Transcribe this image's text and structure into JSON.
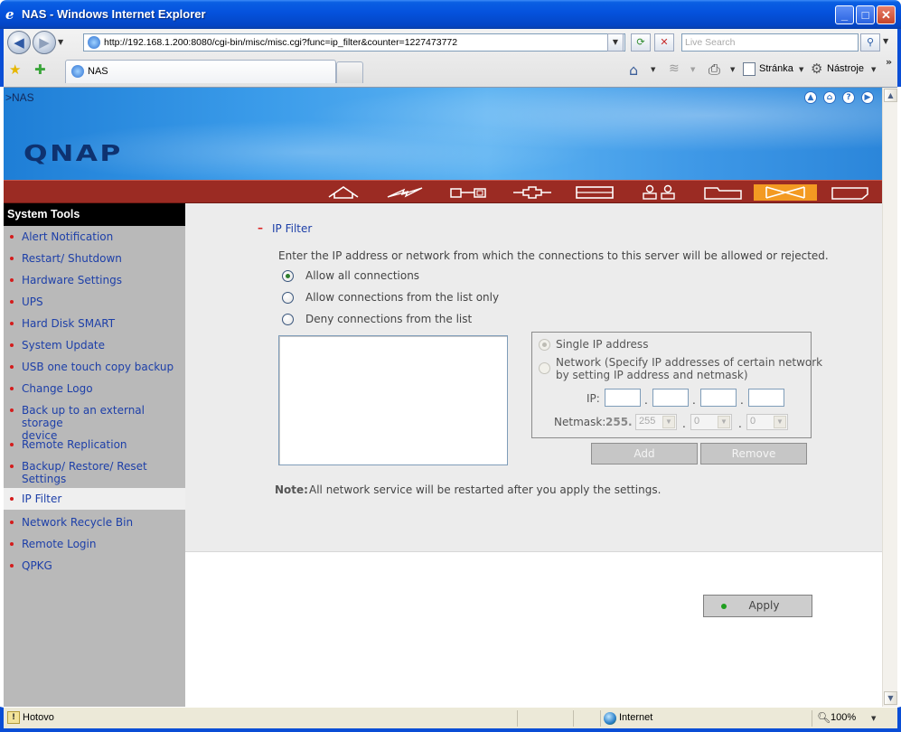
{
  "window": {
    "title": "NAS - Windows Internet Explorer",
    "minimize": "_",
    "maximize": "□",
    "close": "✕"
  },
  "browser": {
    "back_glyph": "◀",
    "forward_glyph": "▶",
    "address": "http://192.168.1.200:8080/cgi-bin/misc/misc.cgi?func=ip_filter&counter=1227473772",
    "search_placeholder": "Live Search",
    "tab_label": "NAS",
    "home_icon": "⌂",
    "feeds_icon": "≋",
    "print_icon": "⎙",
    "page_label": "Stránka",
    "tools_label": "Nástroje",
    "overflow": "»"
  },
  "header": {
    "breadcrumb": ">NAS",
    "logo": "QNAP",
    "nav_icons": [
      "home-icon",
      "network-icon",
      "device-icon",
      "plugin-icon",
      "disk-icon",
      "users-icon",
      "folder-icon",
      "tools-icon",
      "app-icon"
    ],
    "active_nav": "tools-icon"
  },
  "sidebar": {
    "title": "System Tools",
    "items": [
      {
        "label": "Alert Notification"
      },
      {
        "label": "Restart/ Shutdown"
      },
      {
        "label": "Hardware Settings"
      },
      {
        "label": "UPS"
      },
      {
        "label": "Hard Disk SMART"
      },
      {
        "label": "System Update"
      },
      {
        "label": "USB one touch copy backup"
      },
      {
        "label": "Change Logo"
      },
      {
        "label": "Back up to an external storage",
        "label2": "device"
      },
      {
        "label": "Remote Replication"
      },
      {
        "label": "Backup/ Restore/ Reset",
        "label2": "Settings"
      },
      {
        "label": "IP Filter",
        "active": true
      },
      {
        "label": "Network Recycle Bin"
      },
      {
        "label": "Remote Login"
      },
      {
        "label": "QPKG"
      }
    ]
  },
  "main": {
    "section_marker": "–",
    "section_title": "IP Filter",
    "description": "Enter the IP address or network from which the connections to this server will be allowed or rejected.",
    "options": [
      {
        "label": "Allow all connections",
        "checked": true
      },
      {
        "label": "Allow connections from the list only",
        "checked": false
      },
      {
        "label": "Deny connections from the list",
        "checked": false
      }
    ],
    "single_ip_label": "Single IP address",
    "network_label_1": "Network (Specify IP addresses of certain network",
    "network_label_2": "by setting IP address and netmask)",
    "ip_label": "IP:",
    "netmask_label": "Netmask:",
    "netmask_prefix": "255.",
    "netmask_values": [
      "255",
      "0",
      "0"
    ],
    "dot": ".",
    "add_button": "Add",
    "remove_button": "Remove",
    "note_label": "Note:",
    "note_text": "All network service will be restarted after you apply the settings.",
    "apply_button": "Apply"
  },
  "statusbar": {
    "status": "Hotovo",
    "zone": "Internet",
    "zoom": "100%"
  }
}
